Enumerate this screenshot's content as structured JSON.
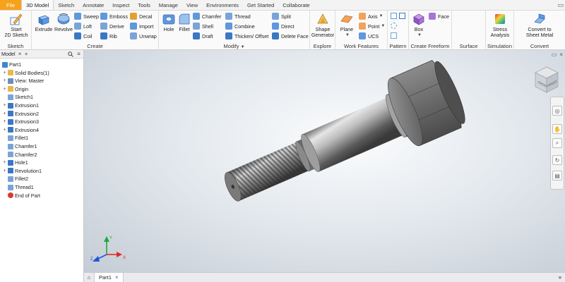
{
  "menu": {
    "file": "File",
    "tabs": [
      "3D Model",
      "Sketch",
      "Annotate",
      "Inspect",
      "Tools",
      "Manage",
      "View",
      "Environments",
      "Get Started",
      "Collaborate"
    ]
  },
  "ribbon": {
    "sketch": {
      "start_line1": "Start",
      "start_line2": "2D Sketch",
      "title": "Sketch"
    },
    "create": {
      "extrude": "Extrude",
      "revolve": "Revolve",
      "sweep": "Sweep",
      "loft": "Loft",
      "coil": "Coil",
      "emboss": "Emboss",
      "derive": "Derive",
      "rib": "Rib",
      "decal": "Decal",
      "import": "Import",
      "unwrap": "Unwrap",
      "title": "Create"
    },
    "modify": {
      "hole": "Hole",
      "fillet": "Fillet",
      "chamfer": "Chamfer",
      "shell": "Shell",
      "draft": "Draft",
      "thread": "Thread",
      "combine": "Combine",
      "thicken": "Thicken/ Offset",
      "split": "Split",
      "direct": "Direct",
      "delete_face": "Delete Face",
      "title": "Modify"
    },
    "explore": {
      "shape_line1": "Shape",
      "shape_line2": "Generator",
      "title": "Explore"
    },
    "work": {
      "plane": "Plane",
      "axis": "Axis",
      "point": "Point",
      "ucs": "UCS",
      "title": "Work Features"
    },
    "pattern": {
      "title": "Pattern"
    },
    "freeform": {
      "box": "Box",
      "face": "Face",
      "title": "Create Freeform"
    },
    "surface": {
      "title": "Surface"
    },
    "simulation": {
      "stress_line1": "Stress",
      "stress_line2": "Analysis",
      "title": "Simulation"
    },
    "convert": {
      "line1": "Convert to",
      "line2": "Sheet Metal",
      "title": "Convert"
    }
  },
  "browser": {
    "tab_label": "Model",
    "add": "+",
    "tree": [
      {
        "label": "Part1",
        "icon": "part-icon",
        "color": "#3b86d6"
      },
      {
        "label": "Solid Bodies(1)",
        "icon": "folder-icon",
        "color": "#e7b948"
      },
      {
        "label": "View: Master",
        "icon": "view-icon",
        "color": "#6f8fb5"
      },
      {
        "label": "Origin",
        "icon": "folder-icon",
        "color": "#e7b948"
      },
      {
        "label": "Sketch1",
        "icon": "sketch-icon",
        "color": "#7aa4d8"
      },
      {
        "label": "Extrusion1",
        "icon": "extrusion-icon",
        "color": "#3a78c4"
      },
      {
        "label": "Extrusion2",
        "icon": "extrusion-icon",
        "color": "#3a78c4"
      },
      {
        "label": "Extrusion3",
        "icon": "extrusion-icon",
        "color": "#3a78c4"
      },
      {
        "label": "Extrusion4",
        "icon": "extrusion-icon",
        "color": "#3a78c4"
      },
      {
        "label": "Fillet1",
        "icon": "fillet-icon",
        "color": "#7aa4d8"
      },
      {
        "label": "Chamfer1",
        "icon": "chamfer-icon",
        "color": "#7aa4d8"
      },
      {
        "label": "Chamfer2",
        "icon": "chamfer-icon",
        "color": "#7aa4d8"
      },
      {
        "label": "Hole1",
        "icon": "hole-icon",
        "color": "#3a78c4"
      },
      {
        "label": "Revolution1",
        "icon": "revolve-icon",
        "color": "#3a78c4"
      },
      {
        "label": "Fillet2",
        "icon": "fillet-icon",
        "color": "#7aa4d8"
      },
      {
        "label": "Thread1",
        "icon": "thread-icon",
        "color": "#7aa4d8"
      },
      {
        "label": "End of Part",
        "icon": "end-of-part-icon",
        "color": "#d93a2b"
      }
    ]
  },
  "viewcube": {
    "front": "FRONT",
    "right": "RIGHT"
  },
  "doc_tabs": {
    "active": "Part1"
  },
  "colors": {
    "file_tab": "#f7a21b",
    "accent": "#2a6fd6"
  }
}
